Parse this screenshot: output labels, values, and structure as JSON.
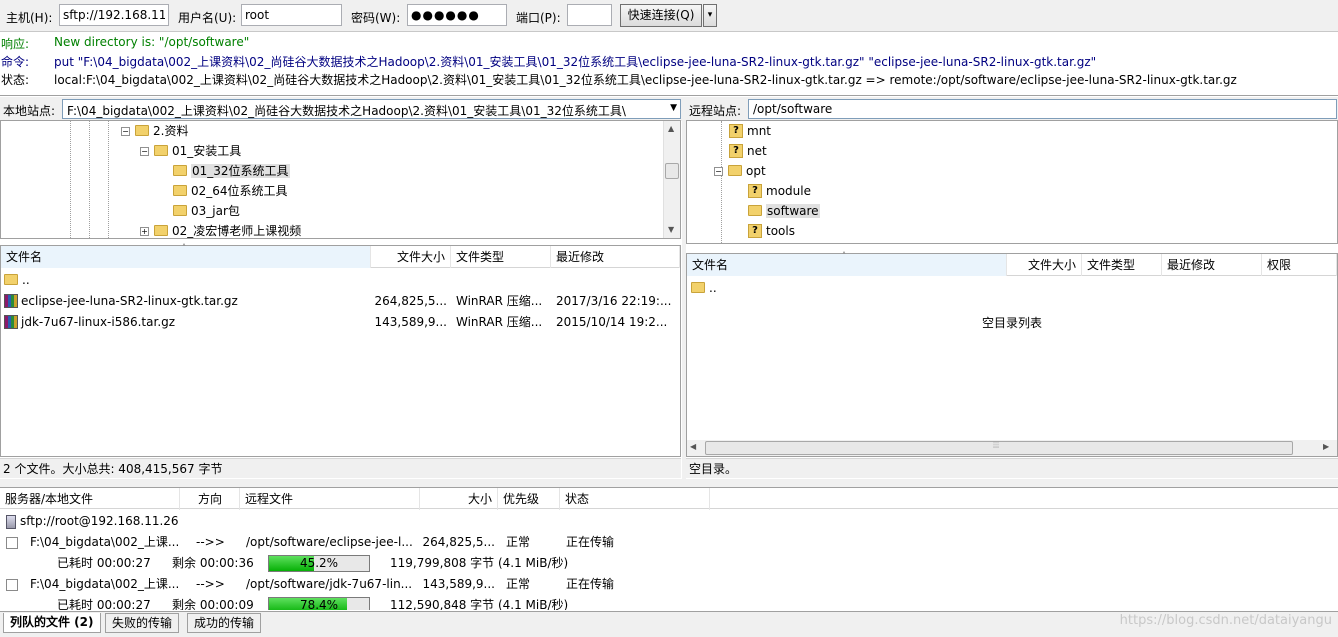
{
  "quickconnect": {
    "host_label": "主机(H):",
    "host_value": "sftp://192.168.11.",
    "user_label": "用户名(U):",
    "user_value": "root",
    "pass_label": "密码(W):",
    "pass_value": "●●●●●●",
    "port_label": "端口(P):",
    "port_value": "",
    "connect_label": "快速连接(Q)",
    "dropdown_label": "▾"
  },
  "log": [
    {
      "key": "响应:",
      "text": "New directory is: \"/opt/software\"",
      "color": "green"
    },
    {
      "key": "命令:",
      "text": "put \"F:\\04_bigdata\\002_上课资料\\02_尚硅谷大数据技术之Hadoop\\2.资料\\01_安装工具\\01_32位系统工具\\eclipse-jee-luna-SR2-linux-gtk.tar.gz\" \"eclipse-jee-luna-SR2-linux-gtk.tar.gz\"",
      "color": "navy"
    },
    {
      "key": "状态:",
      "text": "local:F:\\04_bigdata\\002_上课资料\\02_尚硅谷大数据技术之Hadoop\\2.资料\\01_安装工具\\01_32位系统工具\\eclipse-jee-luna-SR2-linux-gtk.tar.gz => remote:/opt/software/eclipse-jee-luna-SR2-linux-gtk.tar.gz",
      "color": "black"
    }
  ],
  "local": {
    "site_label": "本地站点:",
    "path": "F:\\04_bigdata\\002_上课资料\\02_尚硅谷大数据技术之Hadoop\\2.资料\\01_安装工具\\01_32位系统工具\\",
    "tree": [
      {
        "label": "2.资料",
        "expander": "−"
      },
      {
        "label": "01_安装工具",
        "expander": "−"
      },
      {
        "label": "01_32位系统工具",
        "expander": ""
      },
      {
        "label": "02_64位系统工具",
        "expander": ""
      },
      {
        "label": "03_jar包",
        "expander": ""
      },
      {
        "label": "02_凌宏博老师上课视频",
        "expander": "+"
      }
    ],
    "columns": [
      "文件名",
      "文件大小",
      "文件类型",
      "最近修改"
    ],
    "files": [
      {
        "name": "..",
        "size": "",
        "type": "",
        "modified": ""
      },
      {
        "name": "eclipse-jee-luna-SR2-linux-gtk.tar.gz",
        "size": "264,825,5...",
        "type": "WinRAR 压缩...",
        "modified": "2017/3/16 22:19:..."
      },
      {
        "name": "jdk-7u67-linux-i586.tar.gz",
        "size": "143,589,9...",
        "type": "WinRAR 压缩...",
        "modified": "2015/10/14 19:2..."
      }
    ],
    "status": "2 个文件。大小总共: 408,415,567 字节"
  },
  "remote": {
    "site_label": "远程站点:",
    "path": "/opt/software",
    "tree": [
      {
        "label": "mnt",
        "icon": "question"
      },
      {
        "label": "net",
        "icon": "question"
      },
      {
        "label": "opt",
        "icon": "folder",
        "expander": "−"
      },
      {
        "label": "module",
        "icon": "question"
      },
      {
        "label": "software",
        "icon": "folder"
      },
      {
        "label": "tools",
        "icon": "question"
      }
    ],
    "columns": [
      "文件名",
      "文件大小",
      "文件类型",
      "最近修改",
      "权限"
    ],
    "files": [
      {
        "name": ".."
      }
    ],
    "empty_text": "空目录列表",
    "status": "空目录。"
  },
  "queue": {
    "columns": [
      "服务器/本地文件",
      "方向",
      "远程文件",
      "大小",
      "优先级",
      "状态"
    ],
    "server": "sftp://root@192.168.11.26",
    "items": [
      {
        "local": "F:\\04_bigdata\\002_上课...",
        "direction": "-->>",
        "remote": "/opt/software/eclipse-jee-l...",
        "size": "264,825,5...",
        "priority": "正常",
        "state": "正在传输",
        "elapsed": "已耗时 00:00:27",
        "remaining": "剩余 00:00:36",
        "progress": 45.2,
        "progress_label": "45.2%",
        "bytes": "119,799,808 字节 (4.1 MiB/秒)"
      },
      {
        "local": "F:\\04_bigdata\\002_上课...",
        "direction": "-->>",
        "remote": "/opt/software/jdk-7u67-lin...",
        "size": "143,589,9...",
        "priority": "正常",
        "state": "正在传输",
        "elapsed": "已耗时 00:00:27",
        "remaining": "剩余 00:00:09",
        "progress": 78.4,
        "progress_label": "78.4%",
        "bytes": "112,590,848 字节 (4.1 MiB/秒)"
      }
    ]
  },
  "tabs": [
    "列队的文件 (2)",
    "失败的传输",
    "成功的传输"
  ],
  "watermark": "https://blog.csdn.net/dataiyangu"
}
